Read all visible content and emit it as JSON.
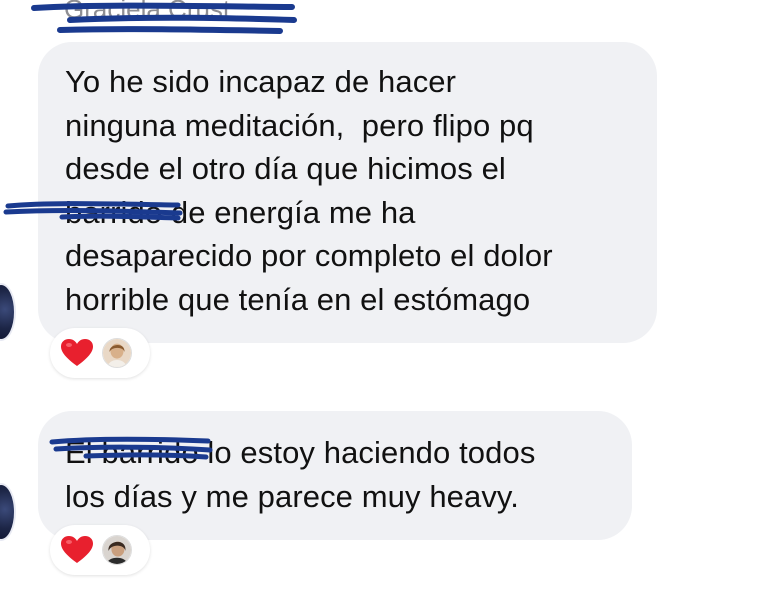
{
  "conversation": {
    "sender_name": "Graciela Crust",
    "messages": [
      {
        "lines": [
          "Yo he sido incapaz de hacer",
          "ninguna meditación,  pero flipo pq",
          "desde el otro día que hicimos el",
          "barrido de energía me ha",
          "desaparecido por completo el dolor",
          "horrible que tenía en el estómago"
        ],
        "reaction": "heart-icon"
      },
      {
        "lines": [
          "El barrido lo estoy haciendo todos",
          "los días y me parece muy heavy."
        ],
        "reaction": "heart-icon"
      }
    ]
  },
  "colors": {
    "bubble_background": "#f0f1f4",
    "text": "#111111",
    "heart": "#e8202e",
    "redaction_scribble": "#1a3a8f"
  }
}
